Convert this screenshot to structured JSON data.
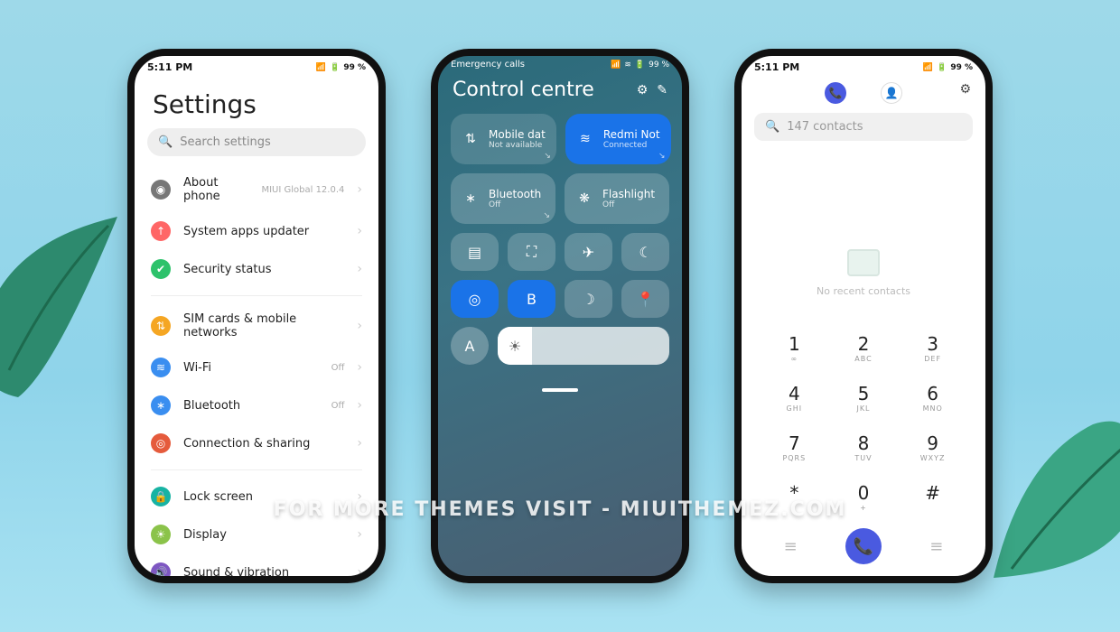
{
  "watermark": "FOR MORE THEMES VISIT - MIUITHEMEZ.COM",
  "status": {
    "time": "5:11 PM",
    "battery": "99 %"
  },
  "settings": {
    "title": "Settings",
    "search_placeholder": "Search settings",
    "items": [
      {
        "label": "About phone",
        "sub": "MIUI Global 12.0.4",
        "icon_bg": "#777",
        "icon": "◉"
      },
      {
        "label": "System apps updater",
        "sub": "",
        "icon_bg": "#f66",
        "icon": "↑"
      },
      {
        "label": "Security status",
        "sub": "",
        "icon_bg": "#2dc26b",
        "icon": "✔"
      }
    ],
    "group2": [
      {
        "label": "SIM cards & mobile networks",
        "sub": "",
        "icon_bg": "#f5a623",
        "icon": "⇅"
      },
      {
        "label": "Wi-Fi",
        "sub": "Off",
        "icon_bg": "#3a8ef0",
        "icon": "≋"
      },
      {
        "label": "Bluetooth",
        "sub": "Off",
        "icon_bg": "#3a8ef0",
        "icon": "∗"
      },
      {
        "label": "Connection & sharing",
        "sub": "",
        "icon_bg": "#e55b3c",
        "icon": "◎"
      }
    ],
    "group3": [
      {
        "label": "Lock screen",
        "sub": "",
        "icon_bg": "#17b3a3",
        "icon": "🔒"
      },
      {
        "label": "Display",
        "sub": "",
        "icon_bg": "#8bc34a",
        "icon": "☀"
      },
      {
        "label": "Sound & vibration",
        "sub": "",
        "icon_bg": "#7e57c2",
        "icon": "🔊"
      }
    ]
  },
  "control": {
    "emergency": "Emergency calls",
    "battery": "99 %",
    "title": "Control centre",
    "tiles": [
      {
        "label": "Mobile dat",
        "sub": "Not available",
        "state": "inactive",
        "icon": "⇅"
      },
      {
        "label": "Redmi Not",
        "sub": "Connected",
        "state": "active",
        "icon": "≋"
      },
      {
        "label": "Bluetooth",
        "sub": "Off",
        "state": "light",
        "icon": "∗"
      },
      {
        "label": "Flashlight",
        "sub": "Off",
        "state": "light",
        "icon": "❋"
      }
    ],
    "small_row1": [
      "▤",
      "⛶",
      "✈",
      "☾"
    ],
    "small_row2_states": [
      "blue",
      "blue",
      "",
      ""
    ],
    "small_row2": [
      "◎",
      "B",
      "☽",
      "📍"
    ],
    "auto_label": "A"
  },
  "dialer": {
    "search_text": "147 contacts",
    "empty_text": "No recent contacts",
    "keys": [
      {
        "num": "1",
        "let": "∞"
      },
      {
        "num": "2",
        "let": "ABC"
      },
      {
        "num": "3",
        "let": "DEF"
      },
      {
        "num": "4",
        "let": "GHI"
      },
      {
        "num": "5",
        "let": "JKL"
      },
      {
        "num": "6",
        "let": "MNO"
      },
      {
        "num": "7",
        "let": "PQRS"
      },
      {
        "num": "8",
        "let": "TUV"
      },
      {
        "num": "9",
        "let": "WXYZ"
      },
      {
        "num": "*",
        "let": ""
      },
      {
        "num": "0",
        "let": "+"
      },
      {
        "num": "#",
        "let": ""
      }
    ]
  }
}
